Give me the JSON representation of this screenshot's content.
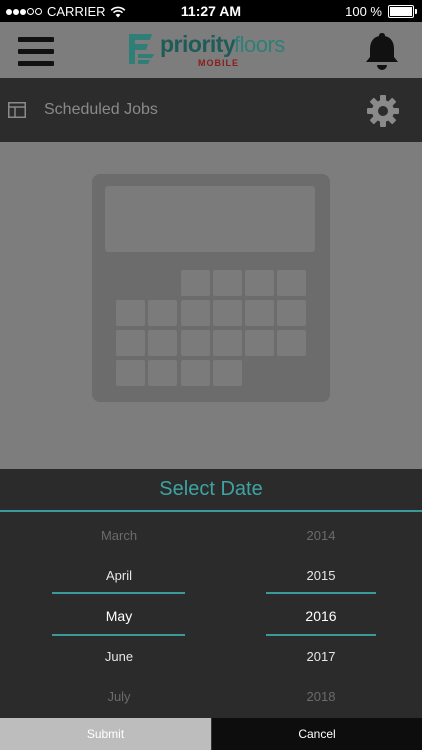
{
  "status_bar": {
    "carrier": "CARRIER",
    "time": "11:27 AM",
    "battery_percent": "100 %",
    "battery_level": 1.0,
    "signal_dots_filled": 3,
    "signal_dots_total": 5
  },
  "header": {
    "logo_primary": "priority",
    "logo_secondary": "floors",
    "logo_sub": "MOBILE",
    "menu_icon": "hamburger-menu-icon",
    "notification_icon": "bell-icon"
  },
  "subheader": {
    "title": "Scheduled Jobs",
    "settings_icon": "gear-icon",
    "left_icon": "window-icon"
  },
  "content": {
    "placeholder_icon": "calculator-icon"
  },
  "picker": {
    "title": "Select Date",
    "months": [
      "March",
      "April",
      "May",
      "June",
      "July"
    ],
    "years": [
      "2014",
      "2015",
      "2016",
      "2017",
      "2018"
    ],
    "selected_month": "May",
    "selected_year": "2016"
  },
  "buttons": {
    "submit": "Submit",
    "cancel": "Cancel"
  },
  "colors": {
    "accent": "#3a9a9a",
    "header_bg": "#7d7d7d",
    "dark_bg": "#2b2b2b",
    "logo_green": "#2f7f78",
    "logo_red": "#8a1c1c"
  }
}
